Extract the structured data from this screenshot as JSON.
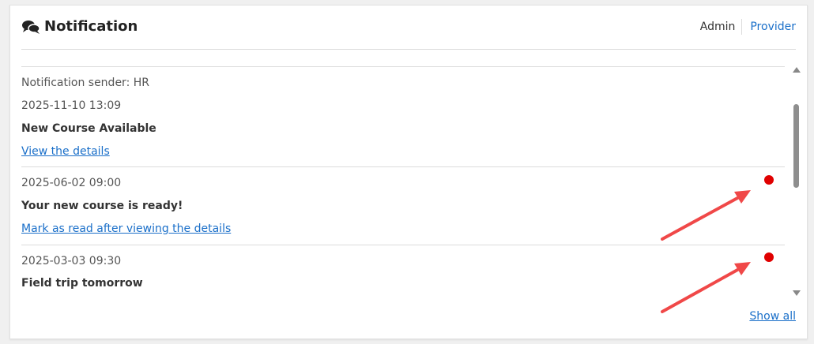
{
  "header": {
    "title": "Notification",
    "title_icon": "chat-bubbles-icon",
    "tabs": [
      {
        "label": "Admin",
        "active": true
      },
      {
        "label": "Provider",
        "active": false
      }
    ]
  },
  "notifications": [
    {
      "sender": "Notification sender: HR",
      "date": "2025-11-10 13:09",
      "subject": "New Course Available",
      "link": "View the details",
      "unread": false
    },
    {
      "date": "2025-06-02 09:00",
      "subject": "Your new course is ready!",
      "link": "Mark as read after viewing the details",
      "unread": true
    },
    {
      "date": "2025-03-03 09:30",
      "subject": "Field trip tomorrow",
      "unread": true
    }
  ],
  "footer": {
    "show_all": "Show all"
  },
  "colors": {
    "link": "#1a6fc9",
    "unread_dot": "#e00000",
    "annotation_arrow": "#f04848"
  }
}
